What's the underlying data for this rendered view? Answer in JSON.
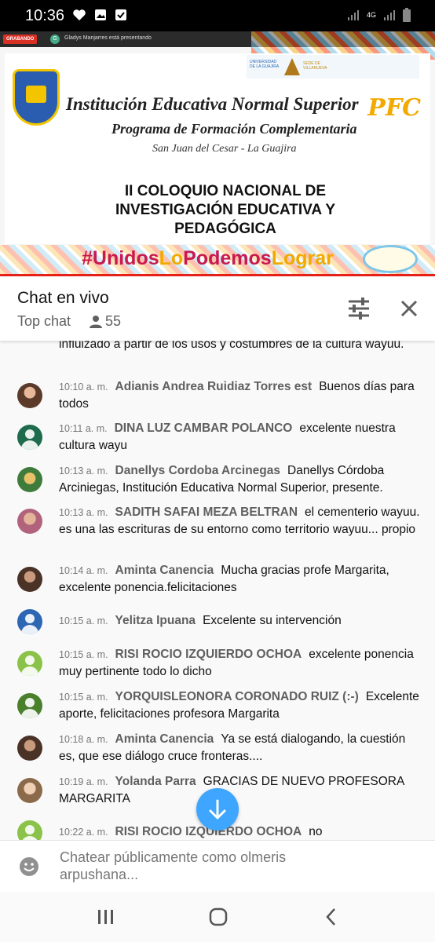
{
  "status_bar": {
    "time": "10:36",
    "network_label": "4G",
    "left_icons": [
      "heart-icon",
      "image-icon",
      "check-box-icon"
    ],
    "right_icons": [
      "wifi-signal-icon",
      "cell-signal-icon",
      "battery-icon"
    ]
  },
  "video": {
    "recording_badge": "GRABANDO",
    "presenter_initial": "G",
    "presenter_text": "Gladys Manjarres está presentando",
    "slide": {
      "university_text": "UNIVERSIDAD DE LA GUAJIRA",
      "university_text2": "SEDE DE VILLANUEVA",
      "institution": "Institución Educativa Normal Superior",
      "program": "Programa de Formación Complementaria",
      "location": "San Juan del Cesar - La Guajira",
      "pfc_logo": "PFC",
      "headline_lines": [
        "II COLOQUIO NACIONAL DE",
        "INVESTIGACIÓN EDUCATIVA Y",
        "PEDAGÓGICA"
      ],
      "hashtag_part1": "#Unidos",
      "hashtag_part2": "Lo",
      "hashtag_part3": "Podemos",
      "hashtag_part4": "Lograr"
    }
  },
  "chat_header": {
    "title": "Chat en vivo",
    "mode": "Top chat",
    "viewer_count": "55"
  },
  "messages": [
    {
      "time": "",
      "author": "",
      "text": "influizado a partir de los usos y costumbres de la cultura wayuu.",
      "avatar": "none",
      "avatar_color": ""
    },
    {
      "time": "10:10 a. m.",
      "author": "Adianis Andrea Ruidiaz Torres est",
      "text": "Buenos días para todos",
      "avatar": "photo",
      "avatar_color": "#8a5a45"
    },
    {
      "time": "10:11 a. m.",
      "author": "DINA LUZ CAMBAR POLANCO",
      "text": "excelente nuestra cultura wayu",
      "avatar": "generic",
      "avatar_color": "#1e6b4e"
    },
    {
      "time": "10:13 a. m.",
      "author": "Danellys Cordoba Arcinegas",
      "text": "Danellys Córdoba Arciniegas, Institución Educativa Normal Superior, presente.",
      "avatar": "photo",
      "avatar_color": "#c9a13a"
    },
    {
      "time": "10:13 a. m.",
      "author": "SADITH SAFAI MEZA BELTRAN",
      "text": "el cementerio wayuu. es una las escrituras de su entorno como territorio wayuu... propio",
      "avatar": "photo",
      "avatar_color": "#b1637c"
    },
    {
      "time": "10:14 a. m.",
      "author": "Aminta Canencia",
      "text": "Mucha gracias profe Margarita, excelente ponencia.felicitaciones",
      "avatar": "photo",
      "avatar_color": "#6b4a3a"
    },
    {
      "time": "10:15 a. m.",
      "author": "Yelitza Ipuana",
      "text": "Excelente su intervención",
      "avatar": "generic",
      "avatar_color": "#2d66b3"
    },
    {
      "time": "10:15 a. m.",
      "author": "RISI ROCIO IZQUIERDO OCHOA",
      "text": "excelente ponencia muy pertinente todo lo dicho",
      "avatar": "generic",
      "avatar_color": "#8bc34a"
    },
    {
      "time": "10:15 a. m.",
      "author": "YORQUISLEONORA CORONADO RUIZ (:-)",
      "text": "Excelente aporte, felicitaciones profesora Margarita",
      "avatar": "generic",
      "avatar_color": "#4a7f2c"
    },
    {
      "time": "10:18 a. m.",
      "author": "Aminta Canencia",
      "text": "Ya se está dialogando, la cuestión es, que ese diálogo cruce fronteras....",
      "avatar": "photo",
      "avatar_color": "#6b4a3a"
    },
    {
      "time": "10:19 a. m.",
      "author": "Yolanda Parra",
      "text": "GRACIAS DE NUEVO PROFESORA MARGARITA",
      "avatar": "photo",
      "avatar_color": "#a88a6a"
    },
    {
      "time": "10:22 a. m.",
      "author": "RISI ROCIO IZQUIERDO OCHOA",
      "text": "no",
      "avatar": "generic",
      "avatar_color": "#8bc34a"
    }
  ],
  "input": {
    "placeholder": "Chatear públicamente como olmeris arpushana..."
  },
  "icons": {
    "filter": "tune-icon",
    "close": "close-icon",
    "scroll_down": "arrow-down-icon",
    "emoji": "emoji-icon",
    "nav_recents": "recents-icon",
    "nav_home": "home-icon",
    "nav_back": "back-icon"
  },
  "colors": {
    "accent_blue": "#3ea6ff",
    "live_red": "#e62117",
    "timestamp_gray": "#777777"
  }
}
